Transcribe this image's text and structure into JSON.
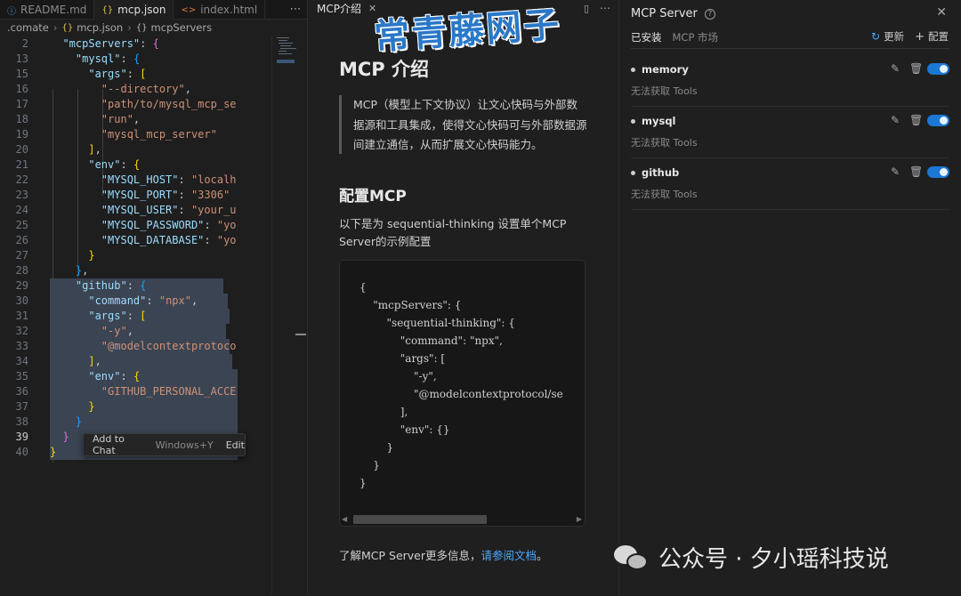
{
  "editor": {
    "tabs": [
      {
        "label": "README.md",
        "icon": "markdown-icon"
      },
      {
        "label": "mcp.json",
        "icon": "json-icon"
      },
      {
        "label": "index.html",
        "icon": "html-icon"
      }
    ],
    "breadcrumb": [
      ".comate",
      "mcp.json",
      "mcpServers"
    ],
    "lines": [
      {
        "n": "2",
        "html": "  <span class='k'>\"mcpServers\"</span><span class='p'>: </span><span class='b2'>{</span>"
      },
      {
        "n": "13",
        "html": "    <span class='k'>\"mysql\"</span><span class='p'>: </span><span class='b3'>{</span>"
      },
      {
        "n": "15",
        "html": "      <span class='k'>\"args\"</span><span class='p'>: </span><span class='b1'>[</span>"
      },
      {
        "n": "16",
        "html": "        <span class='s'>\"--directory\"</span><span class='p'>,</span>"
      },
      {
        "n": "17",
        "html": "        <span class='s'>\"path/to/mysql_mcp_se</span>"
      },
      {
        "n": "18",
        "html": "        <span class='s'>\"run\"</span><span class='p'>,</span>"
      },
      {
        "n": "19",
        "html": "        <span class='s'>\"mysql_mcp_server\"</span>"
      },
      {
        "n": "20",
        "html": "      <span class='b1'>]</span><span class='p'>,</span>"
      },
      {
        "n": "21",
        "html": "      <span class='k'>\"env\"</span><span class='p'>: </span><span class='b1'>{</span>"
      },
      {
        "n": "22",
        "html": "        <span class='k'>\"MYSQL_HOST\"</span><span class='p'>: </span><span class='s'>\"localh</span>"
      },
      {
        "n": "23",
        "html": "        <span class='k'>\"MYSQL_PORT\"</span><span class='p'>: </span><span class='s'>\"3306\"</span>"
      },
      {
        "n": "24",
        "html": "        <span class='k'>\"MYSQL_USER\"</span><span class='p'>: </span><span class='s'>\"your_u</span>"
      },
      {
        "n": "25",
        "html": "        <span class='k'>\"MYSQL_PASSWORD\"</span><span class='p'>: </span><span class='s'>\"yo</span>"
      },
      {
        "n": "26",
        "html": "        <span class='k'>\"MYSQL_DATABASE\"</span><span class='p'>: </span><span class='s'>\"yo</span>"
      },
      {
        "n": "27",
        "html": "      <span class='b1'>}</span>"
      },
      {
        "n": "28",
        "html": "    <span class='b3'>}</span><span class='p'>,</span>"
      },
      {
        "n": "29",
        "html": "    <span class='k'>\"github\"</span><span class='p'>: </span><span class='b3'>{</span>"
      },
      {
        "n": "30",
        "html": "      <span class='k'>\"command\"</span><span class='p'>: </span><span class='s'>\"npx\"</span><span class='p'>,</span>"
      },
      {
        "n": "31",
        "html": "      <span class='k'>\"args\"</span><span class='p'>: </span><span class='b1'>[</span>"
      },
      {
        "n": "32",
        "html": "        <span class='s'>\"-y\"</span><span class='p'>,</span>"
      },
      {
        "n": "33",
        "html": "        <span class='s'>\"@modelcontextprotoco</span>"
      },
      {
        "n": "34",
        "html": "      <span class='b1'>]</span><span class='p'>,</span>"
      },
      {
        "n": "35",
        "html": "      <span class='k'>\"env\"</span><span class='p'>: </span><span class='b1'>{</span>"
      },
      {
        "n": "36",
        "html": "        <span class='s'>\"GITHUB_PERSONAL_ACCE</span>"
      },
      {
        "n": "37",
        "html": "      <span class='b1'>}</span>"
      },
      {
        "n": "38",
        "html": "    <span class='b3'>}</span>"
      },
      {
        "n": "39",
        "html": "  <span class='b2'>}</span>"
      },
      {
        "n": "40",
        "html": "<span class='b1'>}</span>"
      }
    ],
    "tip": {
      "label": "Add to Chat",
      "shortcut": "Windows+Y",
      "edit": "Edit"
    }
  },
  "doc": {
    "tab_label": "MCP介绍",
    "h1": "MCP 介绍",
    "quote": "MCP（模型上下文协议）让文心快码与外部数据源和工具集成，使得文心快码可与外部数据源间建立通信，从而扩展文心快码能力。",
    "h2": "配置MCP",
    "para": "以下是为 sequential-thinking 设置单个MCP Server的示例配置",
    "code_lines": [
      "{",
      "    \"mcpServers\": {",
      "        \"sequential-thinking\": {",
      "            \"command\": \"npx\",",
      "            \"args\": [",
      "                \"-y\",",
      "                \"@modelcontextprotocol/se",
      "            ],",
      "            \"env\": {}",
      "        }",
      "    }",
      "}"
    ],
    "foot_text": "了解MCP Server更多信息，",
    "foot_link": "请参阅文档",
    "foot_end": "。"
  },
  "watermark": "常青藤网子",
  "mcp": {
    "title": "MCP Server",
    "tabs": [
      "已安装",
      "MCP 市场"
    ],
    "refresh_label": "更新",
    "config_label": "配置",
    "servers": [
      {
        "name": "memory",
        "status": "无法获取 Tools",
        "enabled": true
      },
      {
        "name": "mysql",
        "status": "无法获取 Tools",
        "enabled": true
      },
      {
        "name": "github",
        "status": "无法获取 Tools",
        "enabled": true
      }
    ]
  },
  "wechat_footer": "公众号 · 夕小瑶科技说"
}
